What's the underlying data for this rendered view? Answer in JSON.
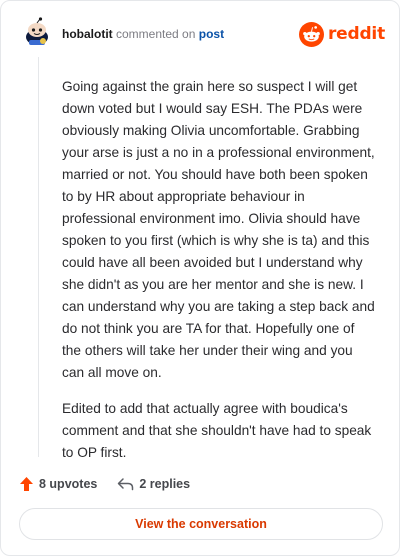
{
  "header": {
    "username": "hobalotit",
    "action_text": "commented on",
    "post_link": "post",
    "brand": "reddit"
  },
  "comment": {
    "paragraphs": [
      "Going against the grain here so suspect I will get down voted but I would say ESH. The PDAs were obviously making Olivia uncomfortable. Grabbing your arse is just a no in a professional environment, married or not. You should have both been spoken to by HR about appropriate behaviour in professional environment imo. Olivia should have spoken to you first (which is why she is ta) and this could have all been avoided but I understand why she didn't as you are her mentor and she is new. I can understand why you are taking a step back and do not think you are TA for that. Hopefully one of the others will take her under their wing and you can all move on.",
      "Edited to add that actually agree with boudica's comment and that she shouldn't have had to speak to OP first."
    ]
  },
  "actions": {
    "upvotes": "8 upvotes",
    "replies": "2 replies"
  },
  "cta": {
    "label": "View the conversation"
  },
  "colors": {
    "brand": "#ff4500",
    "cta_text": "#d93900",
    "link": "#0a52a8"
  },
  "icons": [
    "avatar-snoo",
    "reddit-logo-icon",
    "upvote-arrow-icon",
    "reply-icon"
  ]
}
